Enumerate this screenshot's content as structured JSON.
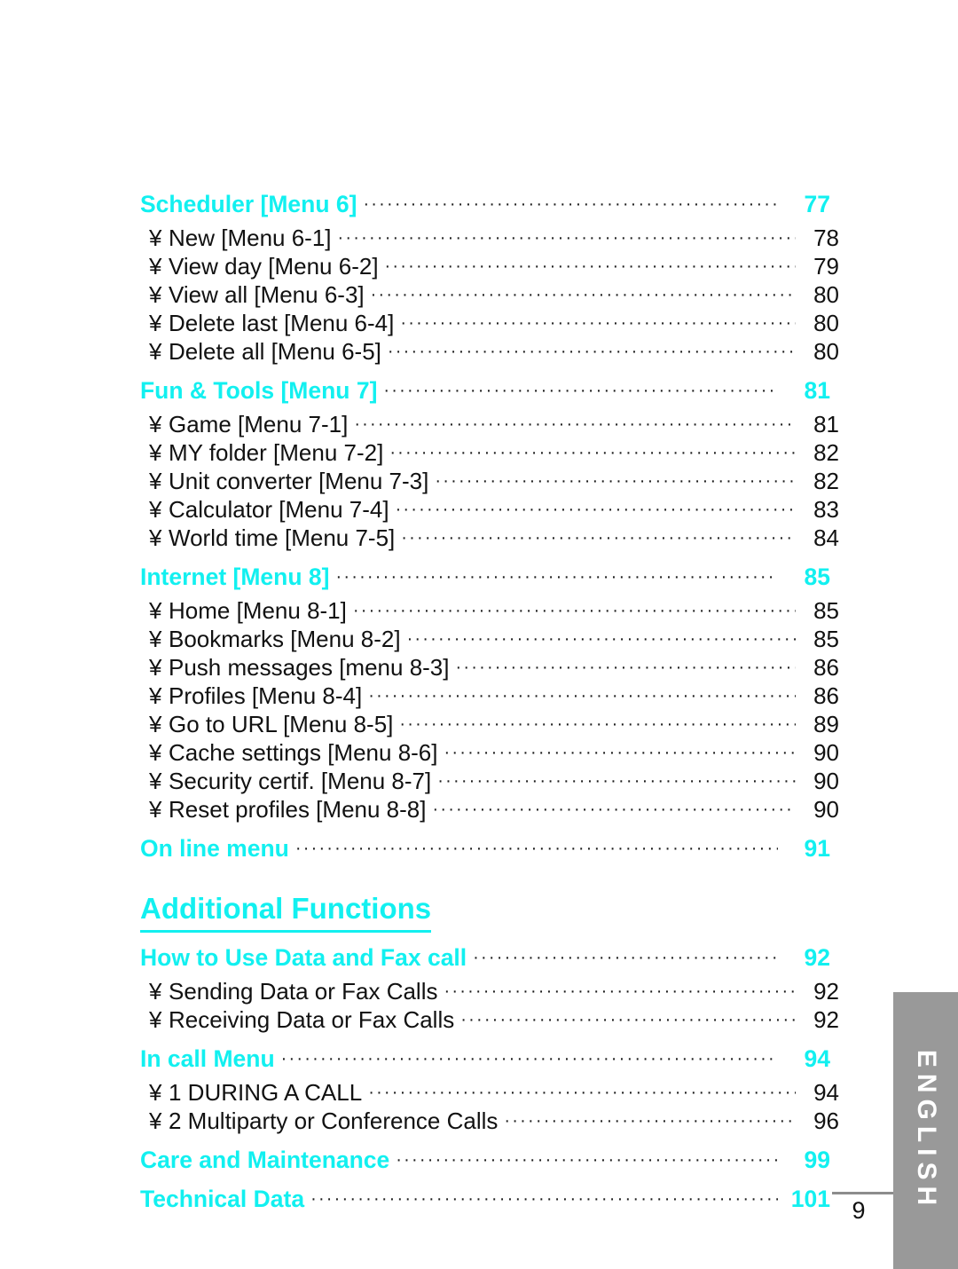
{
  "page": {
    "number": "9",
    "side_tab_label": "ENGLISH"
  },
  "toc": {
    "bullet_glyph": "¥",
    "leader_dots": "·····································································································································",
    "sections": [
      {
        "title": "Scheduler [Menu 6]",
        "page": "77",
        "items": [
          {
            "label": "New [Menu 6-1]",
            "page": "78"
          },
          {
            "label": "View day [Menu 6-2]",
            "page": "79"
          },
          {
            "label": "View all [Menu 6-3]",
            "page": "80"
          },
          {
            "label": "Delete last [Menu 6-4]",
            "page": "80"
          },
          {
            "label": "Delete all [Menu 6-5]",
            "page": "80"
          }
        ]
      },
      {
        "title": "Fun & Tools [Menu 7]",
        "page": "81",
        "items": [
          {
            "label": "Game [Menu 7-1]",
            "page": "81"
          },
          {
            "label": "MY folder [Menu 7-2]",
            "page": "82"
          },
          {
            "label": "Unit converter [Menu 7-3]",
            "page": "82"
          },
          {
            "label": "Calculator [Menu 7-4]",
            "page": "83"
          },
          {
            "label": "World time [Menu 7-5]",
            "page": "84"
          }
        ]
      },
      {
        "title": "Internet [Menu 8]",
        "page": "85",
        "items": [
          {
            "label": "Home [Menu 8-1]",
            "page": "85"
          },
          {
            "label": "Bookmarks [Menu 8-2]",
            "page": "85"
          },
          {
            "label": "Push messages [menu 8-3]",
            "page": "86"
          },
          {
            "label": "Profiles [Menu 8-4]",
            "page": "86"
          },
          {
            "label": "Go to URL [Menu 8-5]",
            "page": "89"
          },
          {
            "label": "Cache settings [Menu 8-6]",
            "page": "90"
          },
          {
            "label": "Security certif. [Menu 8-7]",
            "page": "90"
          },
          {
            "label": "Reset profiles [Menu 8-8]",
            "page": "90"
          }
        ]
      },
      {
        "title": "On line menu",
        "page": "91",
        "items": []
      }
    ],
    "part_title": "Additional Functions",
    "sections_after_part": [
      {
        "title": "How to Use Data and Fax call",
        "page": "92",
        "items": [
          {
            "label": "Sending Data or Fax Calls",
            "page": "92"
          },
          {
            "label": "Receiving Data or Fax Calls",
            "page": "92"
          }
        ]
      },
      {
        "title": "In call Menu",
        "page": "94",
        "items": [
          {
            "label": "1  DURING A CALL",
            "page": "94"
          },
          {
            "label": "2  Multiparty or Conference Calls",
            "page": "96"
          }
        ]
      },
      {
        "title": "Care and Maintenance",
        "page": "99",
        "items": []
      },
      {
        "title": "Technical Data",
        "page": "101",
        "items": []
      }
    ]
  },
  "colors": {
    "accent_cyan": "#12f0f0",
    "tab_gray": "#999999",
    "text_black": "#111111"
  }
}
